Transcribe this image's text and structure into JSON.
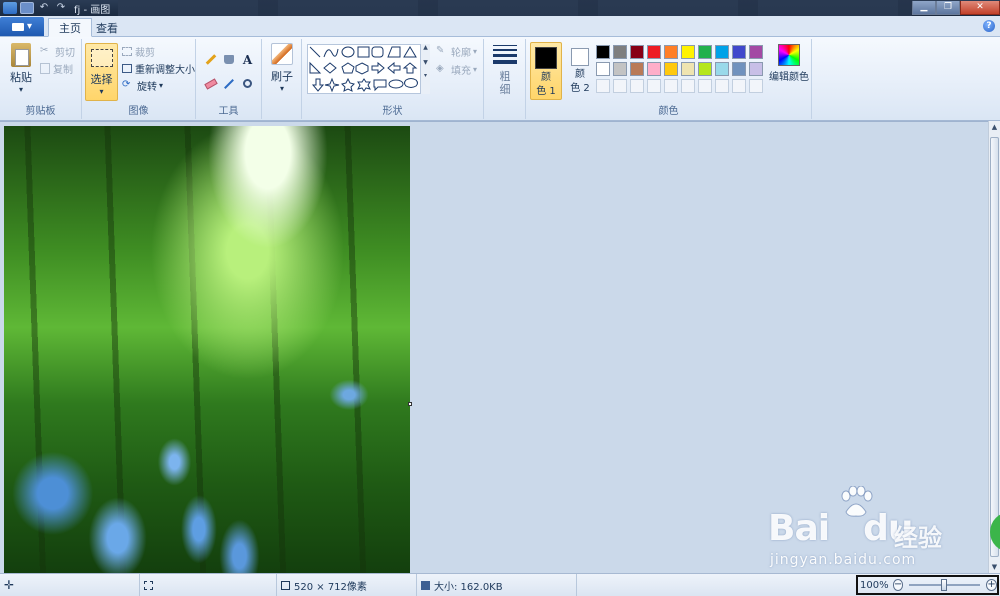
{
  "titlebar": {
    "title": "fj - 画图",
    "undo": "↶",
    "redo": "↷",
    "minimize": "▁",
    "maximize": "❐",
    "close": "✕"
  },
  "tabs": {
    "home": "主页",
    "view": "查看",
    "help": "?"
  },
  "clipboard": {
    "label": "剪贴板",
    "paste": "粘贴",
    "cut": "剪切",
    "copy": "复制"
  },
  "image_group": {
    "label": "图像",
    "select": "选择",
    "crop": "裁剪",
    "resize": "重新调整大小",
    "rotate": "旋转"
  },
  "tools": {
    "label": "工具",
    "text_glyph": "A"
  },
  "brushes": {
    "label": "刷子"
  },
  "shapes": {
    "label": "形状",
    "outline": "轮廓",
    "fill": "填充"
  },
  "size": {
    "label": "粗\n细"
  },
  "colors": {
    "label": "颜色",
    "color1": "颜\n色 1",
    "color2": "颜\n色 2",
    "edit_colors": "编辑颜色",
    "color1_value": "#000000",
    "color2_value": "#ffffff",
    "palette_row1": [
      "#000000",
      "#7f7f7f",
      "#880015",
      "#ed1c24",
      "#ff7f27",
      "#fff200",
      "#22b14c",
      "#00a2e8",
      "#3f48cc",
      "#a349a4"
    ],
    "palette_row2": [
      "#ffffff",
      "#c3c3c3",
      "#b97a57",
      "#ffaec9",
      "#ffc90e",
      "#efe4b0",
      "#b5e61d",
      "#99d9ea",
      "#7092be",
      "#c8bfe7"
    ]
  },
  "statusbar": {
    "dimensions": "520 × 712像素",
    "filesize": "大小: 162.0KB",
    "zoom": "100%",
    "zoom_minus": "−",
    "zoom_plus": "+"
  },
  "watermark": {
    "brand": "Bai",
    "brand2": "du",
    "cn": "经验",
    "url": "jingyan.baidu.com"
  }
}
